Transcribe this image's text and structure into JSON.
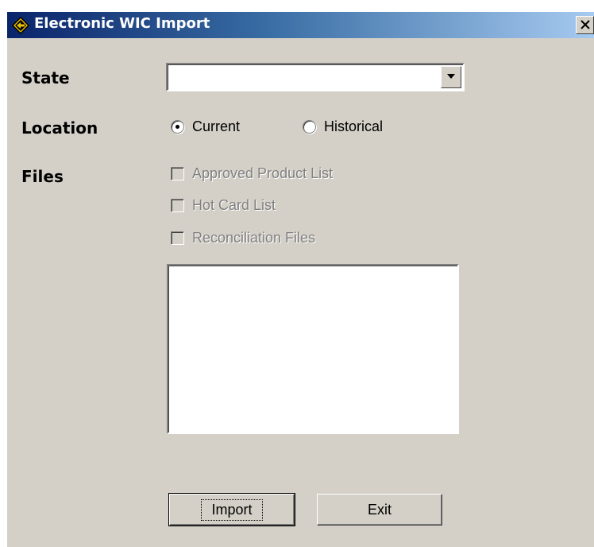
{
  "window": {
    "title": "Electronic WIC Import",
    "close_glyph": "X"
  },
  "form": {
    "state_label": "State",
    "state_value": "",
    "location_label": "Location",
    "location_options": [
      {
        "label": "Current",
        "selected": true
      },
      {
        "label": "Historical",
        "selected": false
      }
    ],
    "files_label": "Files",
    "files_options": [
      {
        "label": "Approved Product List",
        "checked": false,
        "enabled": false
      },
      {
        "label": "Hot Card List",
        "checked": false,
        "enabled": false
      },
      {
        "label": "Reconciliation Files",
        "checked": false,
        "enabled": false
      }
    ]
  },
  "buttons": {
    "import_label": "Import",
    "exit_label": "Exit"
  },
  "colors": {
    "title_bar_start": "#0a246a",
    "title_bar_end": "#a6caf0",
    "dialog_face": "#d4d0c8",
    "disabled_text": "#808080"
  },
  "icons": {
    "title": "diamond-arrow-icon",
    "close": "close-icon",
    "dropdown": "chevron-down-icon"
  }
}
